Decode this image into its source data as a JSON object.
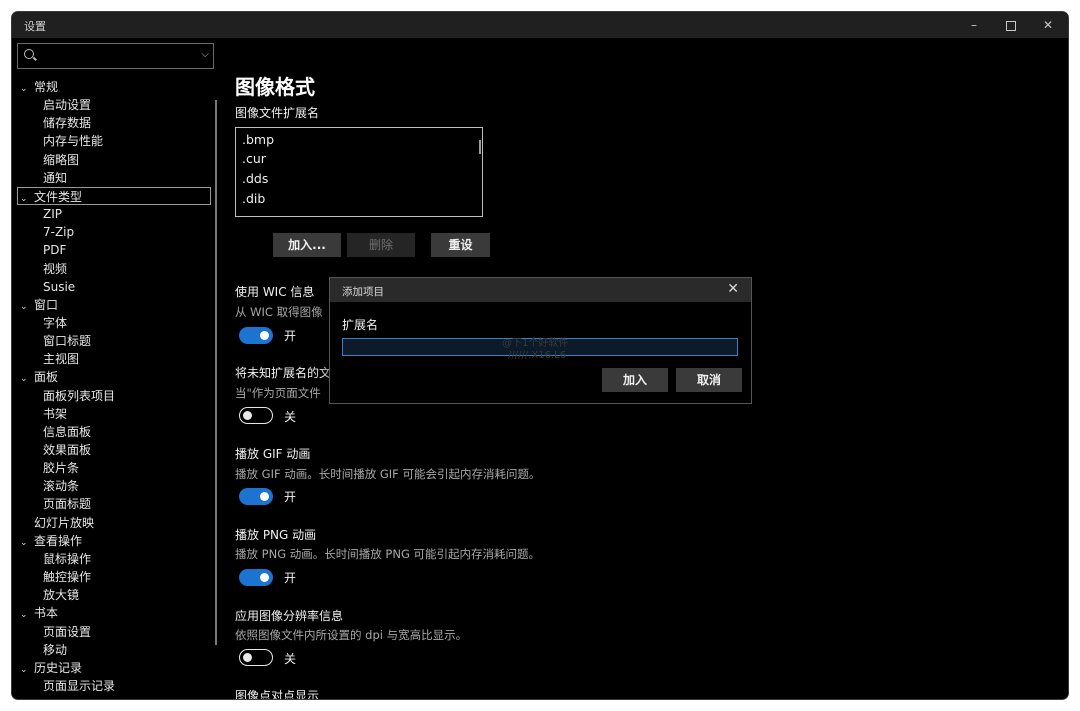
{
  "window": {
    "title": "设置",
    "controls": {
      "minimize": "–",
      "maximize": "",
      "close": "✕"
    }
  },
  "search": {
    "value": "",
    "chevron": "⌵"
  },
  "tree": [
    {
      "label": "常规",
      "level": 0,
      "expanded": true
    },
    {
      "label": "启动设置",
      "level": 1
    },
    {
      "label": "储存数据",
      "level": 1
    },
    {
      "label": "内存与性能",
      "level": 1
    },
    {
      "label": "缩略图",
      "level": 1
    },
    {
      "label": "通知",
      "level": 1
    },
    {
      "label": "文件类型",
      "level": 0,
      "expanded": true,
      "selected": true
    },
    {
      "label": "ZIP",
      "level": 1
    },
    {
      "label": "7-Zip",
      "level": 1
    },
    {
      "label": "PDF",
      "level": 1
    },
    {
      "label": "视频",
      "level": 1
    },
    {
      "label": "Susie",
      "level": 1
    },
    {
      "label": "窗口",
      "level": 0,
      "expanded": true
    },
    {
      "label": "字体",
      "level": 1
    },
    {
      "label": "窗口标题",
      "level": 1
    },
    {
      "label": "主视图",
      "level": 1
    },
    {
      "label": "面板",
      "level": 0,
      "expanded": true
    },
    {
      "label": "面板列表项目",
      "level": 1
    },
    {
      "label": "书架",
      "level": 1
    },
    {
      "label": "信息面板",
      "level": 1
    },
    {
      "label": "效果面板",
      "level": 1
    },
    {
      "label": "胶片条",
      "level": 1
    },
    {
      "label": "滚动条",
      "level": 1
    },
    {
      "label": "页面标题",
      "level": 1
    },
    {
      "label": "幻灯片放映",
      "level": 0,
      "expanded": false
    },
    {
      "label": "查看操作",
      "level": 0,
      "expanded": true
    },
    {
      "label": "鼠标操作",
      "level": 1
    },
    {
      "label": "触控操作",
      "level": 1
    },
    {
      "label": "放大镜",
      "level": 1
    },
    {
      "label": "书本",
      "level": 0,
      "expanded": true
    },
    {
      "label": "页面设置",
      "level": 1
    },
    {
      "label": "移动",
      "level": 1
    },
    {
      "label": "历史记录",
      "level": 0,
      "expanded": true
    },
    {
      "label": "页面显示记录",
      "level": 1
    }
  ],
  "main": {
    "title": "图像格式",
    "ext_label": "图像文件扩展名",
    "extensions": [
      ".bmp",
      ".cur",
      ".dds",
      ".dib"
    ],
    "buttons": {
      "add": "加入...",
      "delete": "删除",
      "reset": "重设"
    },
    "wic": {
      "label": "使用 WIC 信息",
      "desc": "从 WIC 取得图像",
      "state": "开",
      "on": true
    },
    "unknown": {
      "label": "将未知扩展名的文",
      "desc": "当\"作为页面文件",
      "state": "关",
      "on": false
    },
    "gif": {
      "label": "播放 GIF 动画",
      "desc": "播放 GIF 动画。长时间播放 GIF 可能会引起内存消耗问题。",
      "state": "开",
      "on": true
    },
    "png": {
      "label": "播放 PNG 动画",
      "desc": "播放 PNG 动画。长时间播放 PNG 可能引起内存消耗问题。",
      "state": "开",
      "on": true
    },
    "dpi": {
      "label": "应用图像分辨率信息",
      "desc": "依照图像文件内所设置的 dpi 与宽高比显示。",
      "state": "关",
      "on": false
    },
    "dotbydot": {
      "label": "图像点对点显示"
    }
  },
  "dialog": {
    "title": "添加项目",
    "field_label": "扩展名",
    "value": "",
    "ok": "加入",
    "cancel": "取消",
    "close": "✕",
    "watermark": [
      "@下1个好软件",
      "//////.X16.L6"
    ]
  },
  "colors": {
    "accent": "#1c74d0",
    "background": "#000000",
    "titlebar": "#202020"
  }
}
